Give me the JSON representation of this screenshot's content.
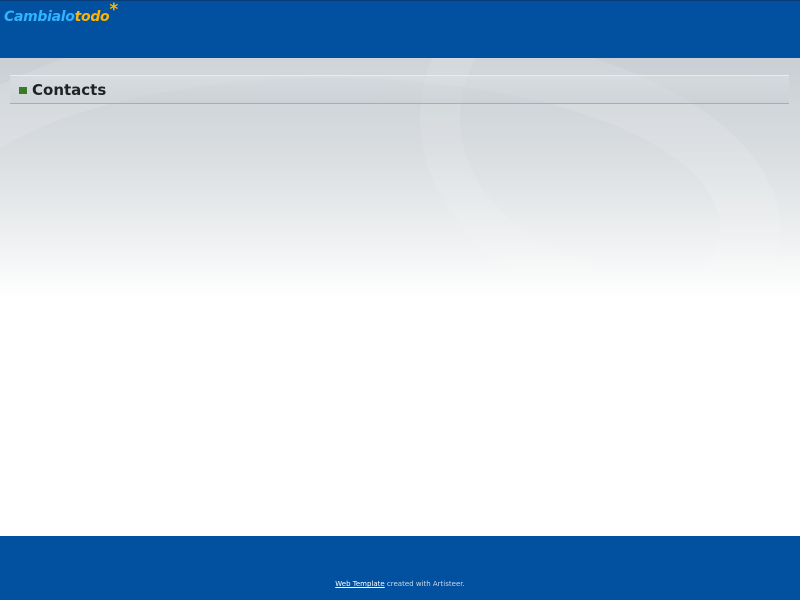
{
  "header": {
    "logo": {
      "part1": "Cambialo",
      "part2": "todo",
      "star": "*"
    }
  },
  "main": {
    "page_title": "Contacts"
  },
  "footer": {
    "link_text": "Web Template",
    "suffix_text": " created with Artisteer."
  },
  "colors": {
    "header_bg": "#0250a0",
    "footer_bg": "#0250a0",
    "logo_blue": "#2fb4ff",
    "logo_orange": "#ffb400",
    "title_marker": "#3d7a25"
  }
}
